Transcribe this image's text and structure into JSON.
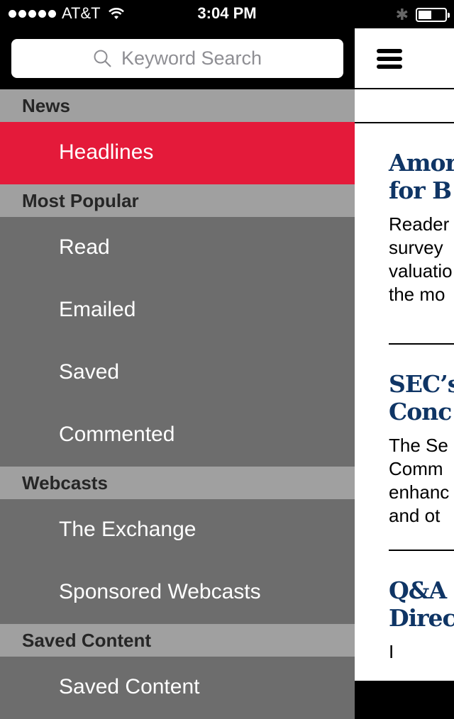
{
  "status_bar": {
    "carrier": "AT&T",
    "time": "3:04 PM",
    "signal_bars": 5,
    "battery_level": 0.5
  },
  "search": {
    "placeholder": "Keyword Search"
  },
  "sidebar": {
    "sections": [
      {
        "title": "News",
        "items": [
          {
            "label": "Headlines",
            "active": true
          }
        ]
      },
      {
        "title": "Most Popular",
        "items": [
          {
            "label": "Read"
          },
          {
            "label": "Emailed"
          },
          {
            "label": "Saved"
          },
          {
            "label": "Commented"
          }
        ]
      },
      {
        "title": "Webcasts",
        "items": [
          {
            "label": "The Exchange"
          },
          {
            "label": "Sponsored Webcasts"
          }
        ]
      },
      {
        "title": "Saved Content",
        "items": [
          {
            "label": "Saved Content"
          }
        ]
      }
    ]
  },
  "content": {
    "articles": [
      {
        "title_lines": [
          "Amor",
          "for B"
        ],
        "summary_lines": [
          "Reader",
          "survey",
          "valuatio",
          "the mo"
        ]
      },
      {
        "title_lines": [
          "SEC’s",
          "Conc"
        ],
        "summary_lines": [
          "The Se",
          "Comm",
          "enhanc",
          "and ot"
        ]
      },
      {
        "title_lines": [
          "Q&A",
          "Direc"
        ],
        "summary_lines": [
          "I"
        ]
      }
    ]
  },
  "colors": {
    "active_item": "#e41a3a",
    "section_header": "#a0a0a0",
    "menu_item": "#6d6d6d",
    "headline": "#0f3565"
  }
}
